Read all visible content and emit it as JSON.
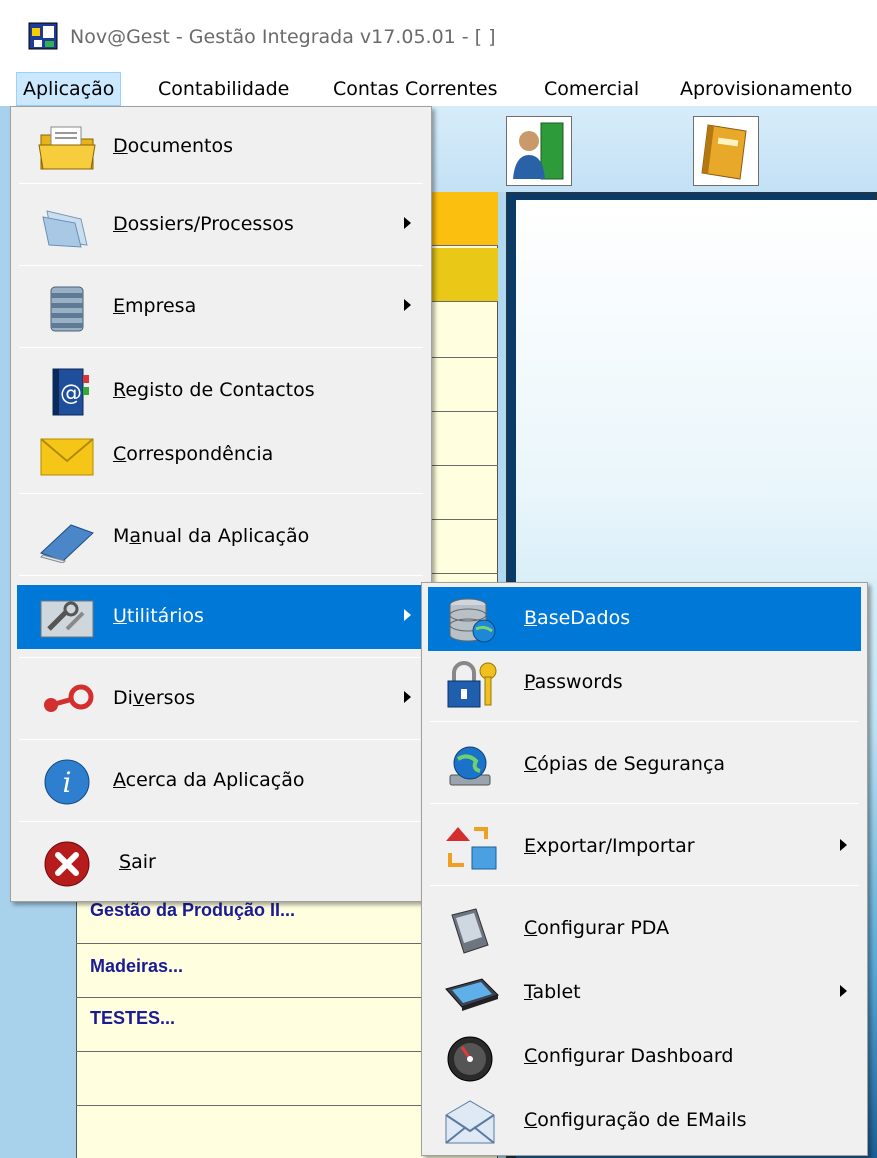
{
  "window": {
    "title": "Nov@Gest - Gestão Integrada v17.05.01 - [ ]"
  },
  "menubar": {
    "items": [
      {
        "label": "Aplicação"
      },
      {
        "label": "Contabilidade"
      },
      {
        "label": "Contas Correntes"
      },
      {
        "label": "Comercial"
      },
      {
        "label": "Aprovisionamento"
      }
    ]
  },
  "background": {
    "list_items": [
      "Gestão da Produção II...",
      "Madeiras...",
      "TESTES..."
    ]
  },
  "main_menu": {
    "items": [
      {
        "label_u": "D",
        "label_rest": "ocumentos",
        "icon": "folder-documents-icon"
      },
      {
        "label_u": "D",
        "label_rest": "ossiers/Processos",
        "icon": "dossiers-icon",
        "submenu": true
      },
      {
        "label_u": "E",
        "label_rest": "mpresa",
        "icon": "company-building-icon",
        "submenu": true
      },
      {
        "label_u": "R",
        "label_rest": "egisto de Contactos",
        "icon": "contacts-book-icon"
      },
      {
        "label_u": "C",
        "label_rest": "orrespondência",
        "icon": "envelope-icon"
      },
      {
        "label_pre": "M",
        "label_u": "a",
        "label_rest": "nual da Aplicação",
        "icon": "manual-book-icon"
      },
      {
        "label_u": "U",
        "label_rest": "tilitários",
        "icon": "utilities-tools-icon",
        "submenu": true,
        "selected": true
      },
      {
        "label_pre": "Di",
        "label_u": "v",
        "label_rest": "ersos",
        "icon": "misc-icon",
        "submenu": true
      },
      {
        "label_u": "A",
        "label_rest": "cerca da Aplicação",
        "icon": "info-icon"
      },
      {
        "label_u": "S",
        "label_rest": "air",
        "icon": "exit-icon"
      }
    ]
  },
  "sub_menu": {
    "items": [
      {
        "label_u": "B",
        "label_rest": "aseDados",
        "icon": "database-icon",
        "selected": true
      },
      {
        "label_u": "P",
        "label_rest": "asswords",
        "icon": "padlock-key-icon"
      },
      {
        "label_u": "C",
        "label_rest": "ópias de Segurança",
        "icon": "backup-globe-icon"
      },
      {
        "label_u": "E",
        "label_rest": "xportar/Importar",
        "icon": "export-import-icon",
        "submenu": true
      },
      {
        "label_u": "C",
        "label_rest": "onfigurar PDA",
        "icon": "pda-icon"
      },
      {
        "label_u": "T",
        "label_rest": "ablet",
        "icon": "tablet-icon",
        "submenu": true
      },
      {
        "label_u": "C",
        "label_rest": "onfigurar Dashboard",
        "icon": "dashboard-gauge-icon"
      },
      {
        "label_u": "C",
        "label_rest": "onfiguração de EMails",
        "icon": "email-config-icon"
      }
    ]
  },
  "colors": {
    "selection": "#0078d7",
    "menu_bg": "#f0f0f0",
    "list_text": "#1b1b96"
  }
}
